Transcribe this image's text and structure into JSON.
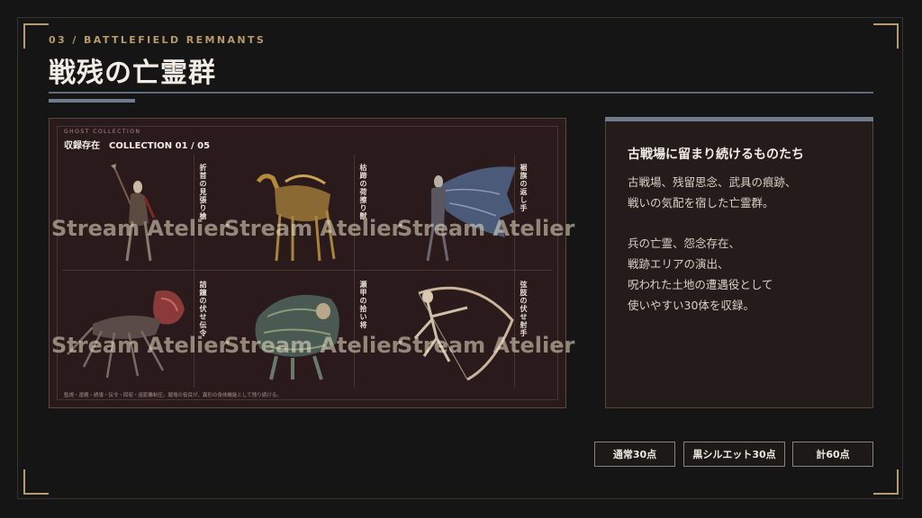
{
  "header": {
    "eyebrow": "03 / BATTLEFIELD REMNANTS",
    "title": "戦残の亡霊群"
  },
  "collection": {
    "eyebrow": "GHOST COLLECTION",
    "title": "収録存在　COLLECTION 01 / 05",
    "footnote": "監視・運搬・誘導・伝令・回収・遠距離制圧。戦場の役目が、異形の身体機能として残り続ける。",
    "watermark": "Stream Atelier",
    "items": [
      {
        "label": "折首の見張り槍"
      },
      {
        "label": "枯蹄の荷擦り獣"
      },
      {
        "label": "裾旗の返し手"
      },
      {
        "label": "詰鐘の伏せ伝令"
      },
      {
        "label": "瀬甲の拾い将"
      },
      {
        "label": "弦肢の伏せ射手"
      }
    ]
  },
  "description": {
    "heading": "古戦場に留まり続けるものたち",
    "para1": [
      "古戦場、残留思念、武具の痕跡、",
      "戦いの気配を宿した亡霊群。"
    ],
    "para2": [
      "兵の亡霊、怨念存在、",
      "戦跡エリアの演出、",
      "呪われた土地の遭遇役として",
      "使いやすい30体を収録。"
    ]
  },
  "tags": [
    "通常30点",
    "黒シルエット30点",
    "計60点"
  ],
  "colors": {
    "accent": "#b89b6c",
    "rule": "#6f7b8b",
    "panel": "#2a1a1b"
  }
}
